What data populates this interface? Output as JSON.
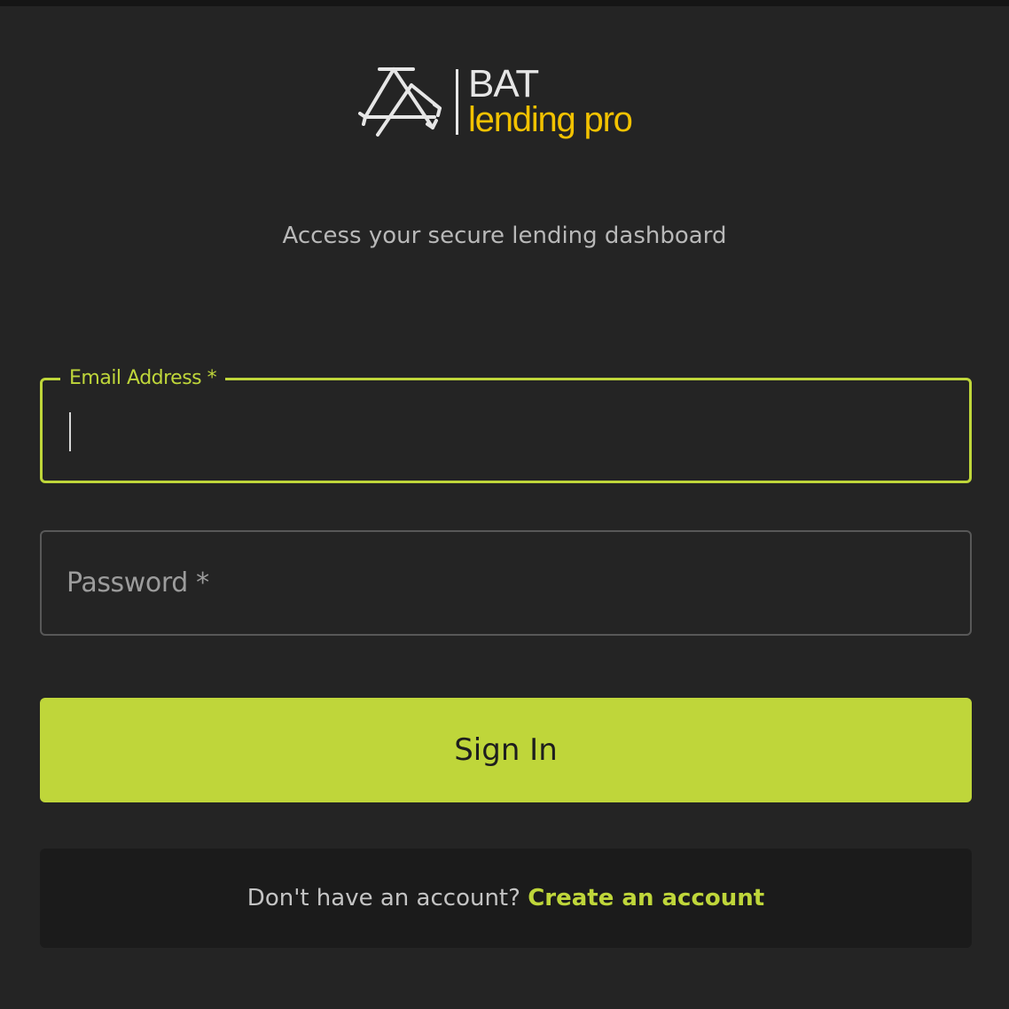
{
  "logo": {
    "brand": "BAT",
    "tagline": "lending pro",
    "icon": "triangle-arrows-logo-icon",
    "tagline_color": "#f2c200"
  },
  "subtitle": "Access your secure lending dashboard",
  "form": {
    "email": {
      "label": "Email Address *",
      "value": ""
    },
    "password": {
      "placeholder": "Password *",
      "value": ""
    },
    "submit_label": "Sign In"
  },
  "register": {
    "prompt": "Don't have an account?",
    "link_label": "Create an account"
  },
  "colors": {
    "accent": "#bfd63a",
    "background": "#242424",
    "panel": "#1b1b1b"
  }
}
